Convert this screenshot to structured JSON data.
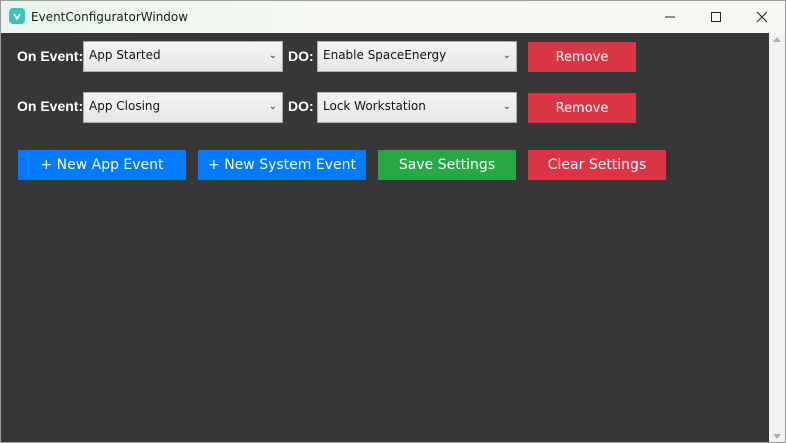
{
  "window": {
    "title": "EventConfiguratorWindow",
    "icon": "app-logo-icon",
    "controls": [
      "minimize-icon",
      "maximize-icon",
      "close-icon"
    ]
  },
  "rows": [
    {
      "on_event_label": "On Event:",
      "event_value": "App Started",
      "do_label": "DO:",
      "action_value": "Enable SpaceEnergy",
      "remove_label": "Remove"
    },
    {
      "on_event_label": "On Event:",
      "event_value": "App Closing",
      "do_label": "DO:",
      "action_value": "Lock Workstation",
      "remove_label": "Remove"
    }
  ],
  "actions": {
    "new_app_event": "+ New App Event",
    "new_system_event": "+ New System Event",
    "save_settings": "Save Settings",
    "clear_settings": "Clear Settings"
  },
  "colors": {
    "background": "#373737",
    "blue": "#007bff",
    "green": "#28a745",
    "red": "#dc3545"
  }
}
